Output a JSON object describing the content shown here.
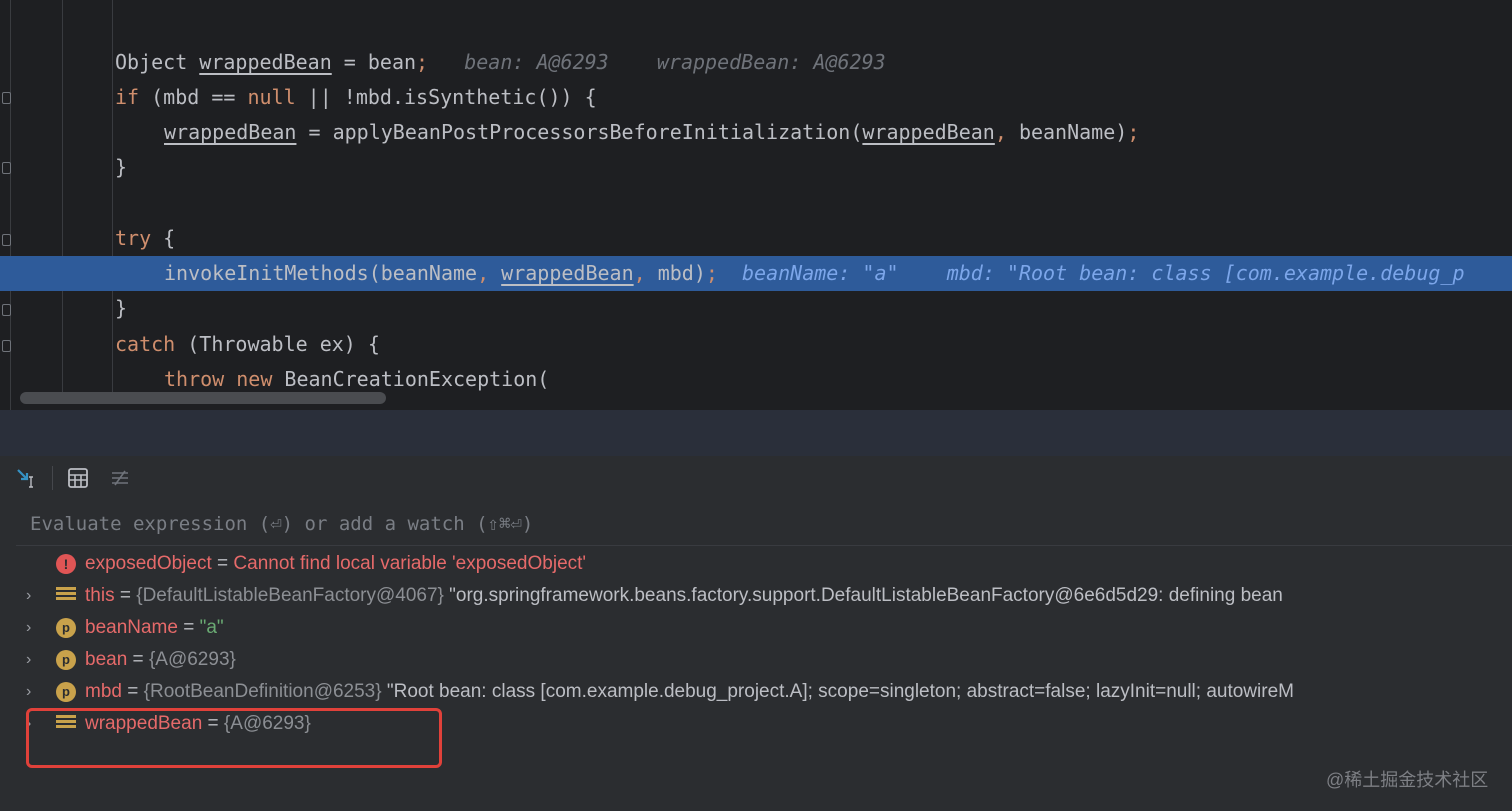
{
  "editor": {
    "lines": [
      {
        "id": "obj",
        "parts": [
          {
            "t": "Object ",
            "c": ""
          },
          {
            "t": "wrappedBean",
            "c": "var"
          },
          {
            "t": " = bean",
            "c": ""
          },
          {
            "t": ";",
            "c": "punct"
          },
          {
            "t": "   bean: A@6293    wrappedBean: A@6293",
            "c": "hint"
          }
        ]
      },
      {
        "id": "if",
        "parts": [
          {
            "t": "if",
            "c": "kw"
          },
          {
            "t": " (mbd == ",
            "c": ""
          },
          {
            "t": "null",
            "c": "kw"
          },
          {
            "t": " || !mbd.isSynthetic()) {",
            "c": ""
          }
        ]
      },
      {
        "id": "apply",
        "parts": [
          {
            "t": "wrappedBean",
            "c": "var"
          },
          {
            "t": " = applyBeanPostProcessorsBeforeInitialization(",
            "c": ""
          },
          {
            "t": "wrappedBean",
            "c": "var"
          },
          {
            "t": ", ",
            "c": "punct"
          },
          {
            "t": "beanName)",
            "c": ""
          },
          {
            "t": ";",
            "c": "punct"
          }
        ]
      },
      {
        "id": "close1",
        "parts": [
          {
            "t": "}",
            "c": ""
          }
        ]
      },
      {
        "id": "try",
        "parts": [
          {
            "t": "try",
            "c": "kw"
          },
          {
            "t": " {",
            "c": ""
          }
        ]
      },
      {
        "id": "invoke",
        "parts": [
          {
            "t": "invokeInitMethods(beanName",
            "c": ""
          },
          {
            "t": ", ",
            "c": "punct"
          },
          {
            "t": "wrappedBean",
            "c": "var"
          },
          {
            "t": ", ",
            "c": "punct"
          },
          {
            "t": "mbd)",
            "c": ""
          },
          {
            "t": ";",
            "c": "punct"
          },
          {
            "t": "  beanName: \"a\"    mbd: \"Root bean: class [com.example.debug_p",
            "c": "hint"
          }
        ]
      },
      {
        "id": "close2",
        "parts": [
          {
            "t": "}",
            "c": ""
          }
        ]
      },
      {
        "id": "catch",
        "parts": [
          {
            "t": "catch",
            "c": "kw"
          },
          {
            "t": " (Throwable ex) {",
            "c": ""
          }
        ]
      },
      {
        "id": "throw",
        "parts": [
          {
            "t": "throw",
            "c": "kw"
          },
          {
            "t": " ",
            "c": ""
          },
          {
            "t": "new",
            "c": "kw"
          },
          {
            "t": " BeanCreationException(",
            "c": ""
          }
        ]
      }
    ]
  },
  "debugger": {
    "evaluate_placeholder": "Evaluate expression (⏎) or add a watch (⇧⌘⏎)",
    "variables": [
      {
        "kind": "error",
        "expandable": false,
        "name": "exposedObject",
        "eq": " = ",
        "type": "",
        "value": "Cannot find local variable 'exposedObject'",
        "value_style": "err"
      },
      {
        "kind": "field",
        "expandable": true,
        "name": "this",
        "eq": " = ",
        "type": "{DefaultListableBeanFactory@4067}",
        "value": " \"org.springframework.beans.factory.support.DefaultListableBeanFactory@6e6d5d29: defining bean",
        "value_style": "str"
      },
      {
        "kind": "param",
        "expandable": true,
        "name": "beanName",
        "eq": " = ",
        "type": "",
        "value": "\"a\"",
        "value_style": "strlit"
      },
      {
        "kind": "param",
        "expandable": true,
        "name": "bean",
        "eq": " = ",
        "type": "{A@6293}",
        "value": "",
        "value_style": "str"
      },
      {
        "kind": "param",
        "expandable": true,
        "name": "mbd",
        "eq": " = ",
        "type": "{RootBeanDefinition@6253}",
        "value": " \"Root bean: class [com.example.debug_project.A]; scope=singleton; abstract=false; lazyInit=null; autowireM",
        "value_style": "str"
      },
      {
        "kind": "field",
        "expandable": true,
        "name": "wrappedBean",
        "eq": " = ",
        "type": "{A@6293}",
        "value": "",
        "value_style": "str"
      }
    ]
  },
  "icons": {
    "param_letter": "p",
    "error_letter": "!",
    "chevron": "›"
  },
  "watermark": "@稀土掘金技术社区",
  "colors": {
    "current_line": "#2e5b9a",
    "keyword": "#cf8e6d",
    "var_name": "#e66a6a",
    "highlight_box": "#e0413a"
  }
}
